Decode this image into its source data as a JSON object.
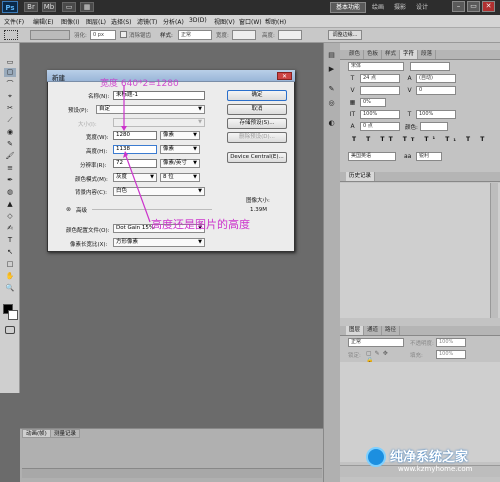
{
  "titlebar": {
    "logo": "Ps",
    "icon_labels": [
      "Br",
      "Mb",
      "▭",
      "▦"
    ],
    "workspaces": {
      "active": "基本功能",
      "items": [
        "绘画",
        "摄影",
        "设计"
      ]
    },
    "window_buttons": [
      "–",
      "▭",
      "✕"
    ]
  },
  "menubar": {
    "items": [
      "文件(F)",
      "编辑(E)",
      "图像(I)",
      "图层(L)",
      "选择(S)",
      "滤镜(T)",
      "分析(A)",
      "3D(D)",
      "视图(V)",
      "窗口(W)",
      "帮助(H)"
    ]
  },
  "options_bar": {
    "feather_label": "羽化:",
    "feather_value": "0 px",
    "antialias_label": "消除锯齿",
    "style_label": "样式:",
    "style_value": "正常",
    "width_label": "宽度:",
    "height_label": "高度:",
    "refine_edge": "调整边缘..."
  },
  "toolbox": {
    "tools": [
      "▭",
      "▢",
      "⌒",
      "⌖",
      "✂",
      "⟋",
      "◉",
      "✎",
      "🖌",
      "≡",
      "✒",
      "◍",
      "▲",
      "◇",
      "✍",
      "T",
      "↖",
      "□",
      "✋",
      "🔍"
    ]
  },
  "dialog": {
    "title": "新建",
    "close": "✕",
    "name_label": "名称(N):",
    "name_value": "未标题-1",
    "preset_label": "预设(P):",
    "preset_value": "自定",
    "size_label": "大小(I):",
    "width_label": "宽度(W):",
    "width_value": "1280",
    "width_unit": "像素",
    "height_label": "高度(H):",
    "height_value": "1138",
    "height_unit": "像素",
    "resolution_label": "分辨率(R):",
    "resolution_value": "72",
    "resolution_unit": "像素/英寸",
    "colormode_label": "颜色模式(M):",
    "colormode_value": "灰度",
    "bitdepth_value": "8 位",
    "background_label": "背景内容(C):",
    "background_value": "白色",
    "advanced_label": "高级",
    "advanced_toggle": "⊗",
    "profile_label": "颜色配置文件(O):",
    "profile_value": "Dot Gain 15%",
    "pixel_aspect_label": "像素长宽比(X):",
    "pixel_aspect_value": "方形像素",
    "buttons": {
      "ok": "确定",
      "cancel": "取消",
      "save_preset": "存储预设(S)...",
      "delete_preset": "删除预设(D)...",
      "device_central": "Device Central(E)..."
    },
    "image_size_label": "图像大小:",
    "image_size_value": "1.39M"
  },
  "annotations": {
    "top": "宽度 640*2=1280",
    "bottom": "高度还是图片的高度"
  },
  "right_panel": {
    "tabs_top": [
      "颜色",
      "色板",
      "样式",
      "字符",
      "段落"
    ],
    "font_family": "宋体",
    "font_size": "24 点",
    "leading": "(自动)",
    "tracking_value": "0",
    "scale_value": "0%",
    "vscale": "100%",
    "hscale": "100%",
    "baseline": "0 点",
    "color_label": "颜色:",
    "language": "美国英语",
    "antialias": "锐利",
    "char_style_buttons": [
      "T",
      "T",
      "TT",
      "Tт",
      "T¹",
      "T₁",
      "T",
      "T"
    ],
    "history_tab": "历史记录",
    "layers_tabs": [
      "图层",
      "通道",
      "路径"
    ],
    "blend_mode": "正常",
    "opacity_label": "不透明度:",
    "opacity_value": "100%",
    "lock_label": "锁定:",
    "fill_label": "填充:",
    "fill_value": "100%"
  },
  "timeline": {
    "tabs": [
      "动画(帧)",
      "测量记录"
    ]
  },
  "watermark": {
    "title": "纯净系统之家",
    "url": "www.kzmyhome.com"
  }
}
